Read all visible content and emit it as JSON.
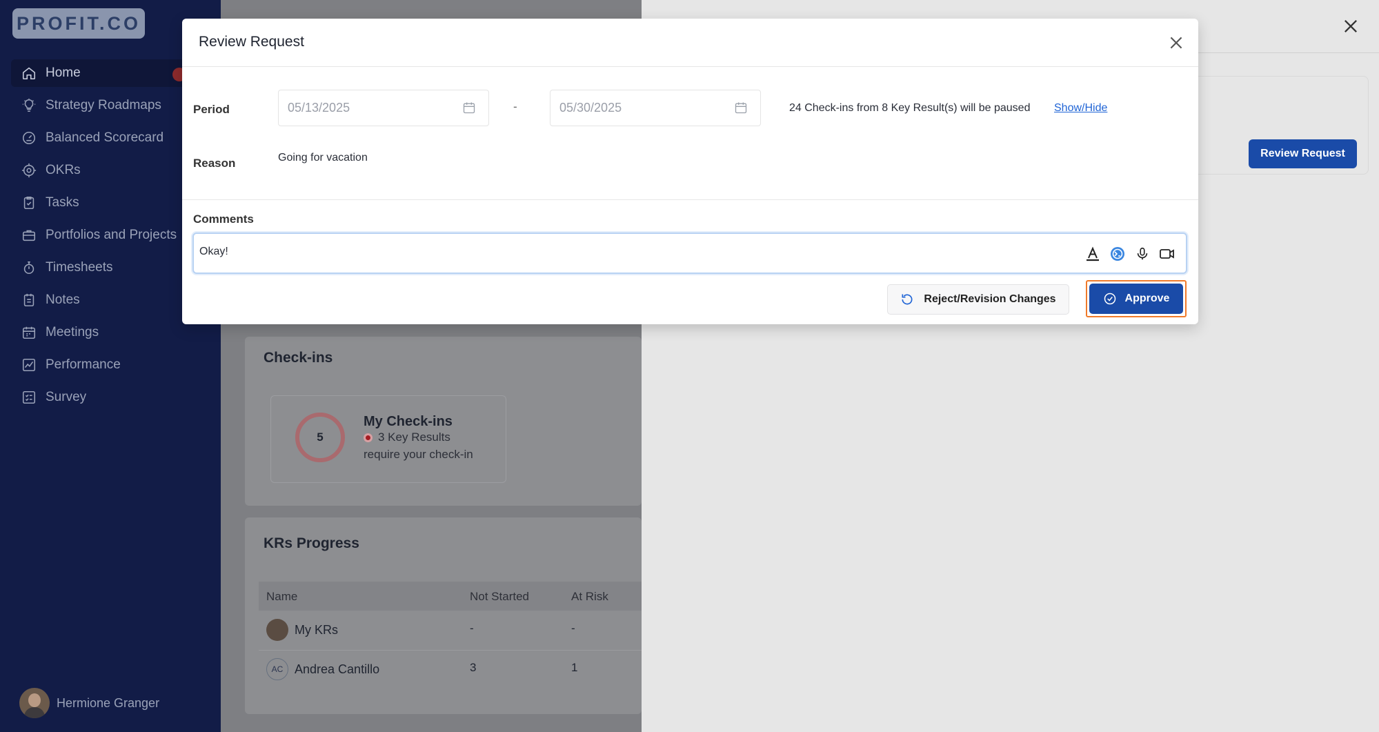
{
  "brand": {
    "logo_text": "PROFIT.CO"
  },
  "sidebar": {
    "items": [
      {
        "label": "Home",
        "icon": "home-icon"
      },
      {
        "label": "Strategy Roadmaps",
        "icon": "lightbulb-icon"
      },
      {
        "label": "Balanced Scorecard",
        "icon": "scorecard-icon"
      },
      {
        "label": "OKRs",
        "icon": "target-icon"
      },
      {
        "label": "Tasks",
        "icon": "clipboard-check-icon"
      },
      {
        "label": "Portfolios and Projects",
        "icon": "briefcase-icon"
      },
      {
        "label": "Timesheets",
        "icon": "stopwatch-icon"
      },
      {
        "label": "Notes",
        "icon": "notes-icon"
      },
      {
        "label": "Meetings",
        "icon": "calendar-icon"
      },
      {
        "label": "Performance",
        "icon": "chart-line-icon"
      },
      {
        "label": "Survey",
        "icon": "survey-icon"
      }
    ],
    "user": {
      "name": "Hermione Granger"
    }
  },
  "background": {
    "checkins": {
      "title": "Check-ins",
      "ring_value": "5",
      "card_title": "My Check-ins",
      "line1": "3 Key Results",
      "line2": "require your check-in"
    },
    "krs_progress": {
      "title": "KRs Progress",
      "columns": [
        "Name",
        "Not Started",
        "At Risk"
      ],
      "rows": [
        {
          "name": "My KRs",
          "not_started": "-",
          "at_risk": "-"
        },
        {
          "initials": "AC",
          "name": "Andrea Cantillo",
          "not_started": "3",
          "at_risk": "1"
        }
      ]
    }
  },
  "panel": {
    "review_button": "Review Request"
  },
  "modal": {
    "title": "Review Request",
    "period_label": "Period",
    "start_date": "05/13/2025",
    "date_separator": "-",
    "end_date": "05/30/2025",
    "pause_text": "24 Check-ins from 8 Key Result(s) will be paused",
    "show_hide": "Show/Hide",
    "reason_label": "Reason",
    "reason_value": "Going for vacation",
    "comments_label": "Comments",
    "comment_value": "Okay!",
    "reject_label": "Reject/Revision Changes",
    "approve_label": "Approve"
  },
  "colors": {
    "sidebar_bg": "#121c47",
    "primary": "#1a4ba8",
    "highlight": "#f07a2a",
    "link": "#1f64d6"
  }
}
